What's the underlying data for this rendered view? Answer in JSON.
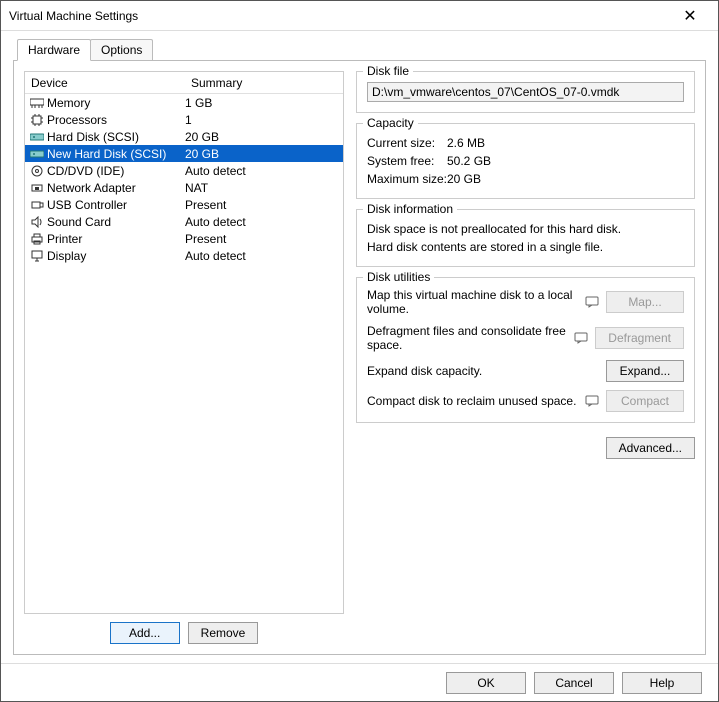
{
  "window": {
    "title": "Virtual Machine Settings"
  },
  "tabs": [
    {
      "label": "Hardware",
      "active": true
    },
    {
      "label": "Options",
      "active": false
    }
  ],
  "device_list": {
    "headers": {
      "device": "Device",
      "summary": "Summary"
    },
    "rows": [
      {
        "icon": "memory-icon",
        "device": "Memory",
        "summary": "1 GB"
      },
      {
        "icon": "processors-icon",
        "device": "Processors",
        "summary": "1"
      },
      {
        "icon": "hard-disk-icon",
        "device": "Hard Disk (SCSI)",
        "summary": "20 GB"
      },
      {
        "icon": "hard-disk-icon",
        "device": "New Hard Disk (SCSI)",
        "summary": "20 GB",
        "selected": true
      },
      {
        "icon": "cd-dvd-icon",
        "device": "CD/DVD (IDE)",
        "summary": "Auto detect"
      },
      {
        "icon": "network-icon",
        "device": "Network Adapter",
        "summary": "NAT"
      },
      {
        "icon": "usb-icon",
        "device": "USB Controller",
        "summary": "Present"
      },
      {
        "icon": "sound-icon",
        "device": "Sound Card",
        "summary": "Auto detect"
      },
      {
        "icon": "printer-icon",
        "device": "Printer",
        "summary": "Present"
      },
      {
        "icon": "display-icon",
        "device": "Display",
        "summary": "Auto detect"
      }
    ],
    "buttons": {
      "add": "Add...",
      "remove": "Remove"
    }
  },
  "right": {
    "disk_file": {
      "legend": "Disk file",
      "value": "D:\\vm_vmware\\centos_07\\CentOS_07-0.vmdk"
    },
    "capacity": {
      "legend": "Capacity",
      "current_label": "Current size:",
      "current_value": "2.6 MB",
      "free_label": "System free:",
      "free_value": "50.2 GB",
      "max_label": "Maximum size:",
      "max_value": "20 GB"
    },
    "disk_info": {
      "legend": "Disk information",
      "line1": "Disk space is not preallocated for this hard disk.",
      "line2": "Hard disk contents are stored in a single file."
    },
    "utilities": {
      "legend": "Disk utilities",
      "map_text": "Map this virtual machine disk to a local volume.",
      "map_btn": "Map...",
      "defrag_text": "Defragment files and consolidate free space.",
      "defrag_btn": "Defragment",
      "expand_text": "Expand disk capacity.",
      "expand_btn": "Expand...",
      "compact_text": "Compact disk to reclaim unused space.",
      "compact_btn": "Compact"
    },
    "advanced_btn": "Advanced..."
  },
  "footer": {
    "ok": "OK",
    "cancel": "Cancel",
    "help": "Help"
  }
}
